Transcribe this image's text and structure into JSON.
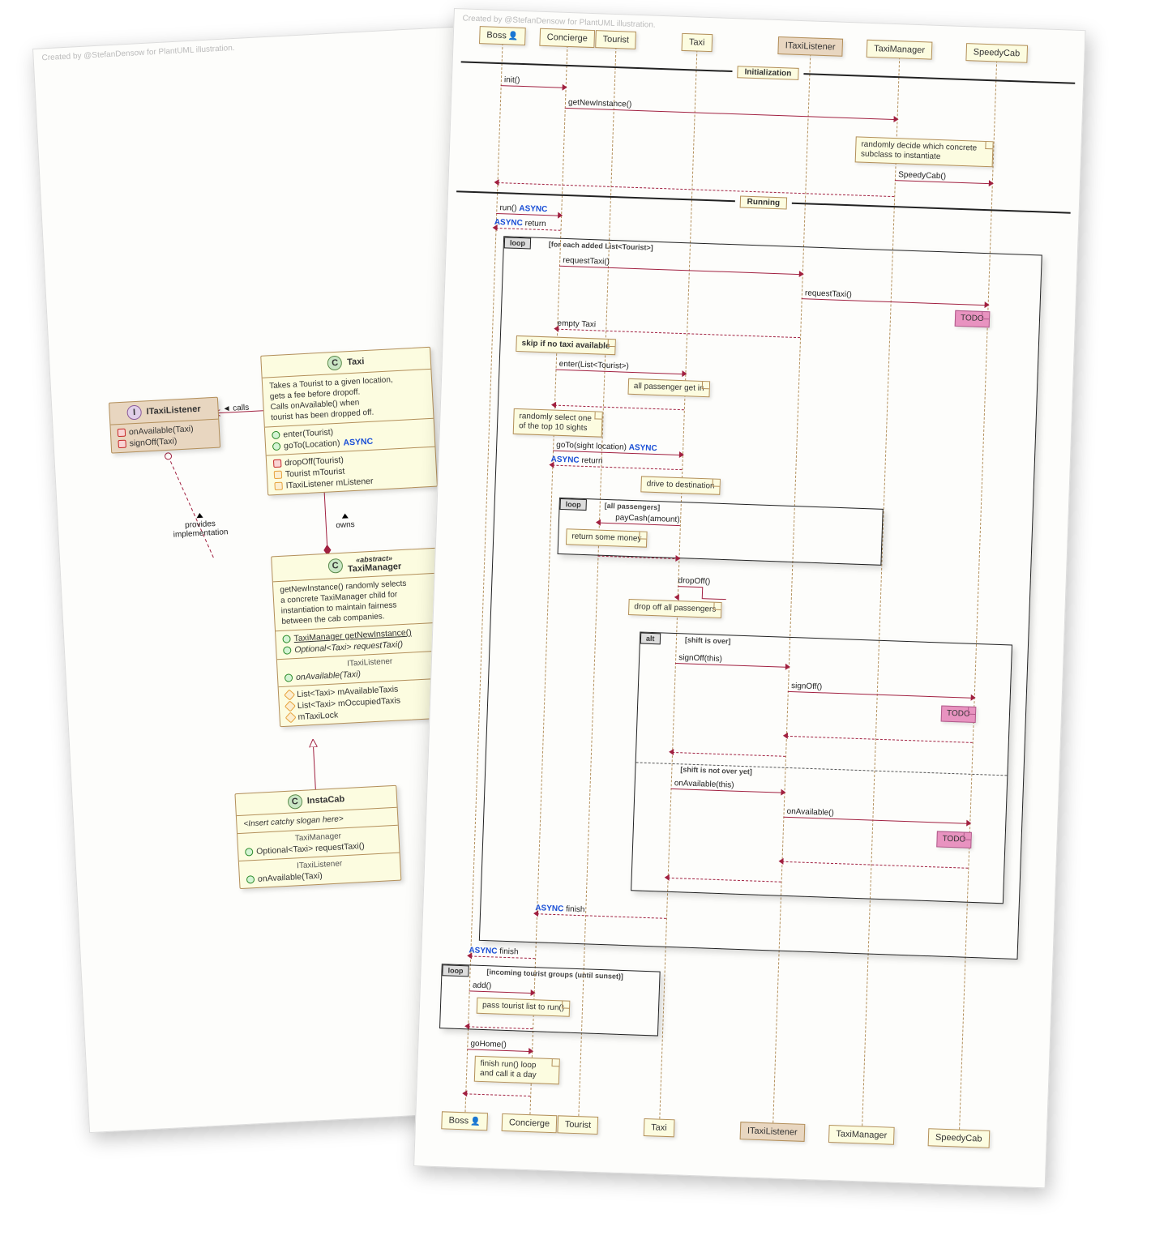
{
  "credit": "Created by @StefanDensow for PlantUML illustration.",
  "class_diagram": {
    "ITaxiListener": {
      "name": "ITaxiListener",
      "members": [
        "onAvailable(Taxi)",
        "signOff(Taxi)"
      ]
    },
    "Taxi": {
      "name": "Taxi",
      "desc_l1": "Takes a Tourist to a given location,",
      "desc_l2": "gets a fee before dropoff.",
      "desc_l3": "Calls onAvailable() when",
      "desc_l4": "tourist has been dropped off.",
      "pub1": "enter(Tourist)",
      "pub2": "goTo(Location)",
      "async": "ASYNC",
      "priv1": "dropOff(Tourist)",
      "prot1": "Tourist mTourist",
      "prot2": "ITaxiListener mListener"
    },
    "TaxiManager": {
      "abstract": "«abstract»",
      "name": "TaxiManager",
      "desc_l1": "getNewInstance() randomly selects",
      "desc_l2": "a concrete TaxiManager child for",
      "desc_l3": "instantiation to maintain fairness",
      "desc_l4": "between the cab companies.",
      "static1": "TaxiManager getNewInstance()",
      "abs1": "Optional<Taxi> requestTaxi()",
      "iface_label": "ITaxiListener",
      "impl1": "onAvailable(Taxi)",
      "prot1": "List<Taxi> mAvailableTaxis",
      "prot2": "List<Taxi> mOccupiedTaxis",
      "prot3": "mTaxiLock"
    },
    "InstaCab": {
      "name": "InstaCab",
      "slogan": "<Insert catchy slogan here>",
      "parent_label": "TaxiManager",
      "m1": "Optional<Taxi> requestTaxi()",
      "iface_label": "ITaxiListener",
      "m2": "onAvailable(Taxi)"
    },
    "rel_calls": "calls",
    "rel_provides": "provides\nimplementation",
    "rel_owns": "owns"
  },
  "sequence": {
    "participants": {
      "boss": "Boss",
      "concierge": "Concierge",
      "tourist": "Tourist",
      "taxi": "Taxi",
      "listener": "ITaxiListener",
      "manager": "TaxiManager",
      "speedy": "SpeedyCab"
    },
    "divider_init": "Initialization",
    "divider_run": "Running",
    "msgs": {
      "init": "init()",
      "getNew": "getNewInstance()",
      "note_subclass_l1": "randomly decide which concrete",
      "note_subclass_l2": "subclass to instantiate",
      "speedycab": "SpeedyCab()",
      "run": "run()",
      "async": "ASYNC",
      "async_return": "return",
      "loop1_guard": "[for each added List<Tourist>]",
      "requestTaxi": "requestTaxi()",
      "todo": "TODO",
      "emptyTaxi": "empty Taxi",
      "note_skip": "skip if no taxi available",
      "enter": "enter(List<Tourist>)",
      "note_getin": "all passenger get in",
      "note_sight_l1": "randomly select one",
      "note_sight_l2": "of the top 10 sights",
      "goTo": "goTo(sight location)",
      "note_drive": "drive to destination",
      "loop2_guard": "[all passengers]",
      "payCash": "payCash(amount)",
      "note_money": "return some money",
      "dropOff": "dropOff()",
      "note_dropoff": "drop off all passengers",
      "alt_guard1": "[shift is over]",
      "signOff": "signOff(this)",
      "signOff2": "signOff()",
      "alt_guard2": "[shift is not over yet]",
      "onAvail": "onAvailable(this)",
      "onAvail2": "onAvailable()",
      "async_finish": "finish",
      "loop3_guard": "[incoming tourist groups (until sunset)]",
      "add": "add()",
      "note_pass": "pass tourist list to run()",
      "goHome": "goHome()",
      "note_gohome_l1": "finish run() loop",
      "note_gohome_l2": "and call it a day"
    },
    "frag": {
      "loop": "loop",
      "alt": "alt"
    }
  }
}
